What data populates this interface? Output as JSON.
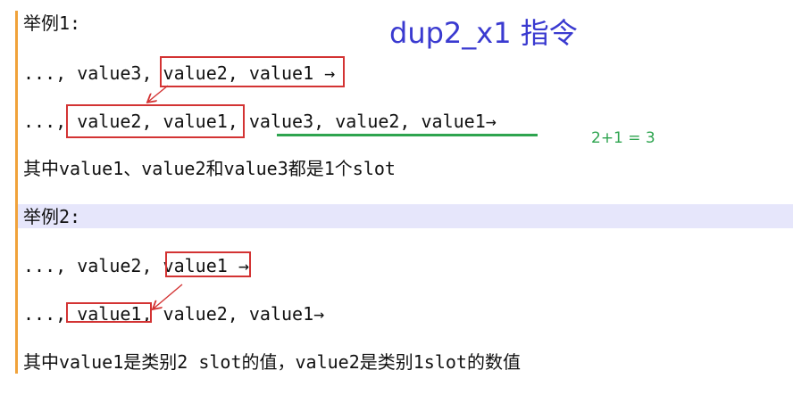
{
  "title": "dup2_x1 指令",
  "note": "2+1 = 3",
  "example1": {
    "label": "举例1:",
    "line1": "..., value3, value2, value1 →",
    "line2": "..., value2, value1, value3, value2, value1→",
    "desc": "其中value1、value2和value3都是1个slot"
  },
  "example2": {
    "label": "举例2:",
    "line1": "..., value2, value1 →",
    "line2": "..., value1, value2, value1→",
    "desc": "其中value1是类别2 slot的值，value2是类别1slot的数值"
  },
  "colors": {
    "title": "#3a3ad0",
    "box": "#d33333",
    "underline": "#2ea44f",
    "gutter": "#f0a23a",
    "highlight": "#e6e6fb"
  }
}
